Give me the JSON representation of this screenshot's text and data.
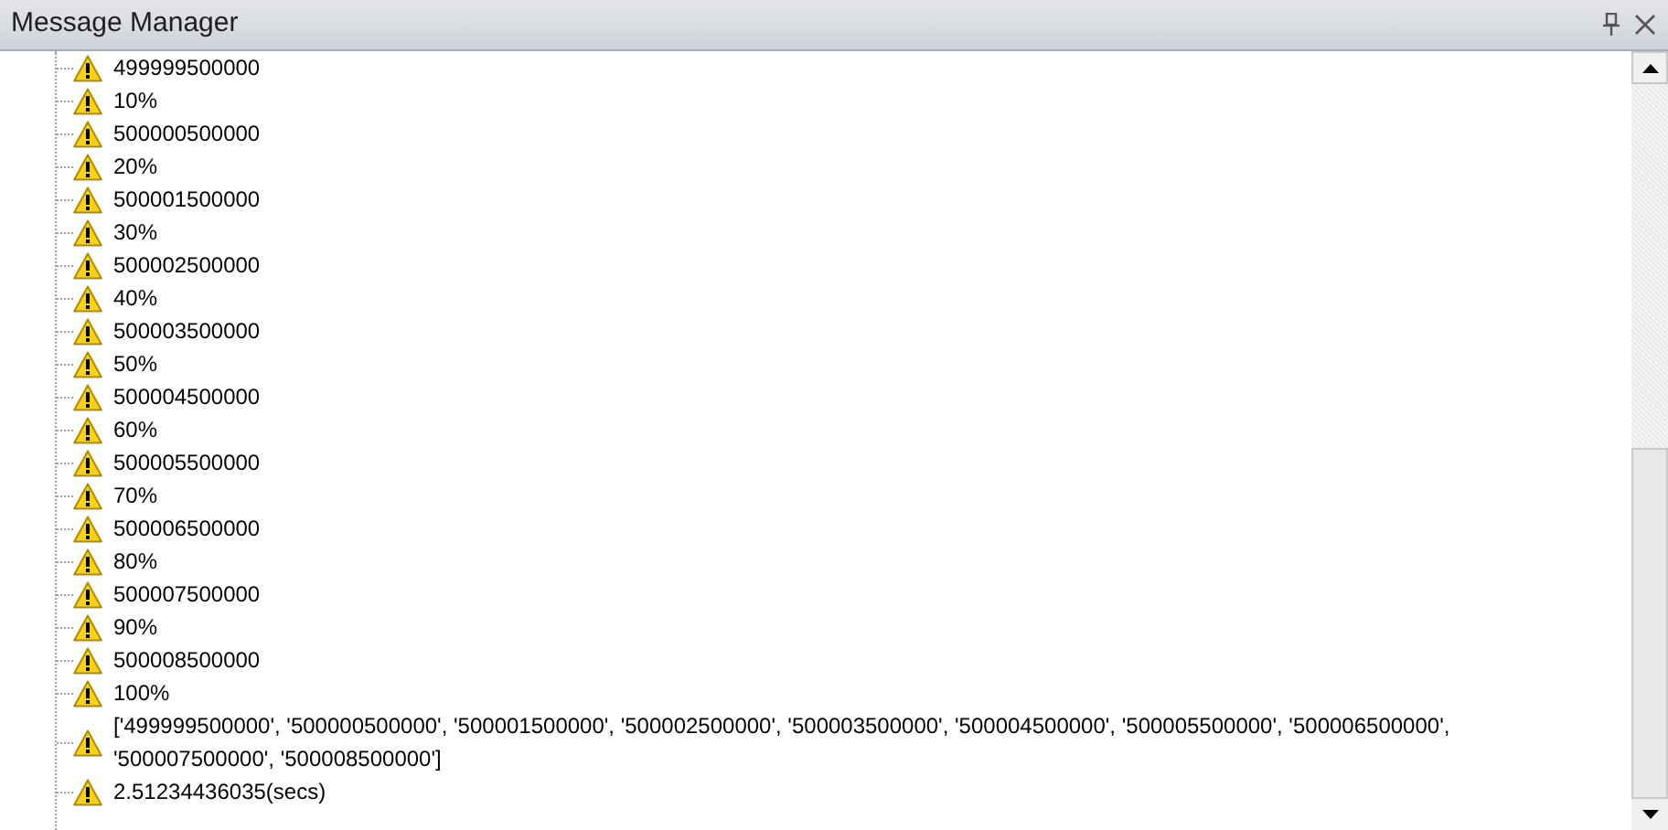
{
  "window": {
    "title": "Message Manager"
  },
  "messages": [
    {
      "text": "499999500000"
    },
    {
      "text": "10%"
    },
    {
      "text": "500000500000"
    },
    {
      "text": "20%"
    },
    {
      "text": "500001500000"
    },
    {
      "text": "30%"
    },
    {
      "text": "500002500000"
    },
    {
      "text": "40%"
    },
    {
      "text": "500003500000"
    },
    {
      "text": "50%"
    },
    {
      "text": "500004500000"
    },
    {
      "text": "60%"
    },
    {
      "text": "500005500000"
    },
    {
      "text": "70%"
    },
    {
      "text": "500006500000"
    },
    {
      "text": "80%"
    },
    {
      "text": "500007500000"
    },
    {
      "text": "90%"
    },
    {
      "text": "500008500000"
    },
    {
      "text": "100%"
    },
    {
      "text": "['499999500000', '500000500000', '500001500000', '500002500000', '500003500000', '500004500000', '500005500000', '500006500000', '500007500000', '500008500000']"
    },
    {
      "text": "2.51234436035(secs)"
    }
  ]
}
